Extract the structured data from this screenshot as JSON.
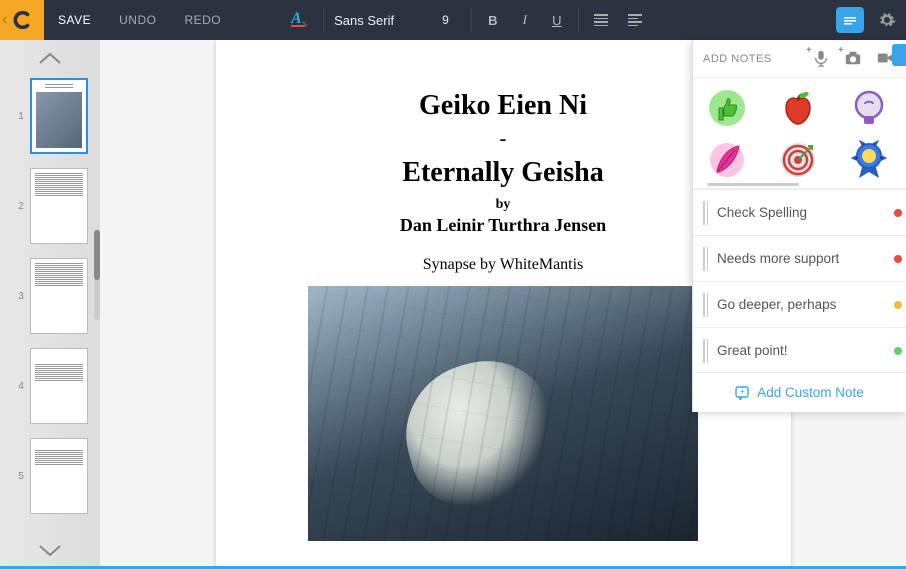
{
  "toolbar": {
    "save": "SAVE",
    "undo": "UNDO",
    "redo": "REDO",
    "font_name": "Sans Serif",
    "font_size": "9",
    "bold": "B",
    "italic": "I",
    "underline": "U"
  },
  "thumbnails": {
    "pages": [
      "1",
      "2",
      "3",
      "4",
      "5"
    ],
    "selected_index": 0
  },
  "document": {
    "title_line1": "Geiko Eien Ni",
    "title_dash": "-",
    "title_line2": "Eternally Geisha",
    "by_label": "by",
    "author": "Dan Leinir Turthra Jensen",
    "credit": "Synapse by WhiteMantis"
  },
  "notes": {
    "header": "ADD NOTES",
    "stickers": [
      {
        "name": "thumbs-up",
        "color": "#4fbf3a",
        "bg": "#9de88f"
      },
      {
        "name": "apple",
        "color": "#e23a2a",
        "bg": "transparent"
      },
      {
        "name": "lightbulb",
        "color": "#8a5cc4",
        "bg": "#e6dff2"
      },
      {
        "name": "feather",
        "color": "#e2349a",
        "bg": "#ffc3e6"
      },
      {
        "name": "target",
        "color": "#e23a2a",
        "bg": "#c9e6f5"
      },
      {
        "name": "ribbon",
        "color": "#2a5cc4",
        "bg": "transparent"
      }
    ],
    "items": [
      {
        "text": "Check Spelling",
        "dot": "#e94a3a"
      },
      {
        "text": "Needs more support",
        "dot": "#e94a3a"
      },
      {
        "text": "Go deeper, perhaps",
        "dot": "#f4b83a"
      },
      {
        "text": "Great point!",
        "dot": "#5ad468"
      }
    ],
    "add_custom": "Add Custom Note"
  }
}
